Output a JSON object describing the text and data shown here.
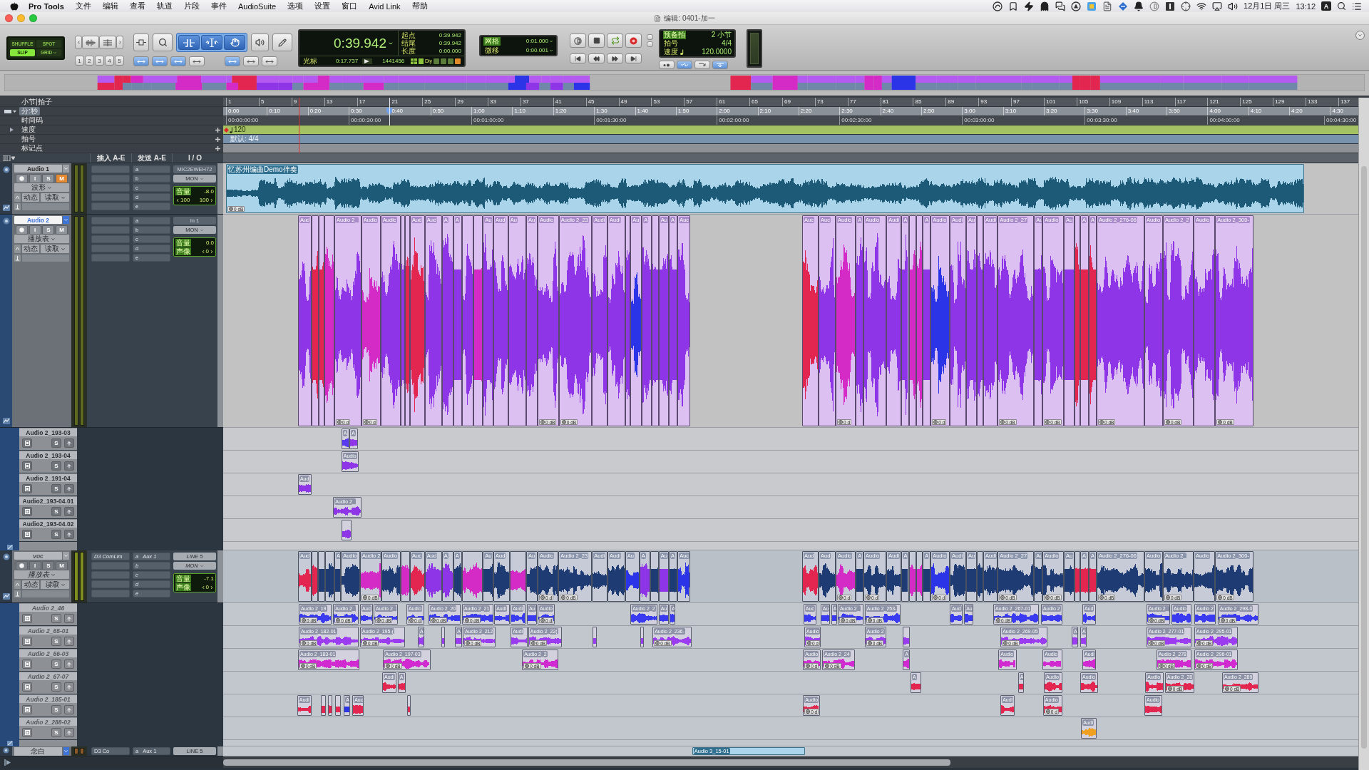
{
  "menu_bar": {
    "app": "Pro Tools",
    "items": [
      "文件",
      "编辑",
      "查看",
      "轨道",
      "片段",
      "事件",
      "AudioSuite",
      "选项",
      "设置",
      "窗口",
      "Avid Link",
      "帮助"
    ],
    "input_source": "A",
    "date": "12月1日 周三",
    "time": "13:12"
  },
  "window": {
    "title": "编辑: 0401-加一"
  },
  "toolbar": {
    "edit_modes": [
      {
        "label": "SHUFFLE",
        "selected": false
      },
      {
        "label": "SPOT",
        "selected": false
      },
      {
        "label": "SLIP",
        "selected": true
      },
      {
        "label": "GRID",
        "selected": false
      }
    ],
    "zoom_presets": [
      "1",
      "2",
      "3",
      "4",
      "5"
    ],
    "tools": [
      {
        "kind": "zoom",
        "selected": false
      },
      {
        "kind": "trim",
        "selected": true
      },
      {
        "kind": "select",
        "selected": true
      },
      {
        "kind": "grab",
        "selected": true
      },
      {
        "kind": "scrub",
        "selected": false
      },
      {
        "kind": "pencil",
        "selected": false
      }
    ],
    "toggles": [
      {
        "on": true
      },
      {
        "on": true
      },
      {
        "on": true
      },
      {
        "on": false
      },
      {
        "on": true
      },
      {
        "on": false
      },
      {
        "on": false
      }
    ],
    "counter": {
      "main": "0:39.942",
      "rows": [
        {
          "label": "起点",
          "value": "0:39.942"
        },
        {
          "label": "结尾",
          "value": "0:39.942"
        },
        {
          "label": "长度",
          "value": "0:00.000"
        }
      ],
      "cursor_label": "光标",
      "cursor": "0:17.737",
      "samples": "1441456",
      "delay": "Dly"
    },
    "grid": {
      "label": "网格",
      "value": "0:01.000"
    },
    "nudge": {
      "label": "微移",
      "value": "0:00.001"
    },
    "tempo": {
      "countoff_label": "预备拍",
      "countoff": "2 小节",
      "meter_label": "拍号",
      "meter": "4/4",
      "tempo_label": "速度",
      "tempo": "120.0000"
    }
  },
  "rulers": [
    {
      "kind": "bars",
      "label": "小节|拍子",
      "selected": false,
      "ticks": [
        "1",
        "5",
        "9",
        "13",
        "17",
        "21",
        "25",
        "29",
        "33",
        "37",
        "41",
        "45",
        "49",
        "53",
        "57",
        "61",
        "65",
        "69",
        "73",
        "77",
        "81",
        "85",
        "89",
        "93",
        "97",
        "101",
        "105",
        "109",
        "113",
        "117",
        "121",
        "125",
        "129",
        "133",
        "137"
      ]
    },
    {
      "kind": "minsec",
      "label": "分:秒",
      "selected": true,
      "ticks": [
        "0:00",
        "0:10",
        "0:20",
        "0:30",
        "0:40",
        "0:50",
        "1:00",
        "1:10",
        "1:20",
        "1:30",
        "1:40",
        "1:50",
        "2:00",
        "2:10",
        "2:20",
        "2:30",
        "2:40",
        "2:50",
        "3:00",
        "3:10",
        "3:20",
        "3:30",
        "3:40",
        "3:50",
        "4:00",
        "4:10",
        "4:20",
        "4:30"
      ]
    },
    {
      "kind": "timecode",
      "label": "时间码",
      "selected": false,
      "ticks": [
        "00:00:00:00",
        "00:00:30:00",
        "00:01:00:00",
        "00:01:30:00",
        "00:02:00:00",
        "00:02:30:00",
        "00:03:00:00",
        "00:03:30:00",
        "00:04:00:00",
        "00:04:30:00"
      ]
    },
    {
      "kind": "tempo",
      "label": "速度",
      "selected": false,
      "value": "120"
    },
    {
      "kind": "meter",
      "label": "拍号",
      "selected": false,
      "value": "默认: 4/4"
    },
    {
      "kind": "markers",
      "label": "标记点",
      "selected": false
    }
  ],
  "columns": [
    "插入 A-E",
    "发送 A-E",
    "I / O"
  ],
  "tracks": [
    {
      "kind": "audio",
      "name": "Audio 1",
      "selected": false,
      "inactive": false,
      "controls": [
        {
          "kind": "record",
          "on": false
        },
        {
          "kind": "input",
          "label": "I",
          "on": false
        },
        {
          "kind": "solo",
          "label": "S",
          "on": false
        },
        {
          "kind": "mute",
          "label": "M",
          "on": true
        }
      ],
      "view": "波形",
      "automation": "动态",
      "mode": "读取",
      "sends": [
        {
          "slot": "a"
        },
        {
          "slot": "b"
        },
        {
          "slot": "c"
        },
        {
          "slot": "d"
        },
        {
          "slot": "e"
        }
      ],
      "io": {
        "input": "MIC2EWEH72",
        "output": "MON",
        "volume_label": "音量",
        "volume": "-8.0",
        "pan": [
          {
            "value": "100"
          },
          {
            "value": "100"
          }
        ]
      },
      "clips": [
        {
          "label": "忆苏州编曲Demo伴奏",
          "gain": "0 dB"
        }
      ]
    },
    {
      "kind": "audio",
      "name": "Audio 2",
      "selected": true,
      "inactive": false,
      "controls": [
        {
          "kind": "record",
          "on": false
        },
        {
          "kind": "input",
          "label": "I",
          "on": false
        },
        {
          "kind": "solo",
          "label": "S",
          "on": false
        },
        {
          "kind": "mute",
          "label": "M",
          "on": false
        }
      ],
      "view": "播放表",
      "automation": "动态",
      "mode": "读取",
      "sends": [
        {
          "slot": "a"
        },
        {
          "slot": "b"
        },
        {
          "slot": "c"
        },
        {
          "slot": "d"
        },
        {
          "slot": "e"
        }
      ],
      "io": {
        "input": "In 1",
        "output": "MON",
        "volume_label": "音量",
        "volume": "0.0",
        "pan_label": "声像",
        "pan": [
          {
            "value": "0"
          }
        ]
      },
      "clips": [
        {
          "label": "Aud",
          "color": "#8f35e8"
        },
        {
          "color": "#e2264f"
        },
        {
          "color": "#e2264f"
        },
        {
          "color": "#d42ac6"
        },
        {
          "label": "Audio 2_",
          "color": "#8f35e8",
          "gain": "0 d"
        },
        {
          "label": "Audio",
          "color": "#d42ac6",
          "gain": "0 d"
        },
        {
          "label": "Audic",
          "color": "#8f35e8"
        },
        {
          "color": "#8f35e8"
        },
        {
          "color": "#e2264f"
        },
        {
          "label": "Aud",
          "color": "#e2264f"
        },
        {
          "label": "Aud",
          "color": "#8f35e8"
        },
        {
          "label": "A",
          "color": "#8f35e8"
        },
        {
          "label": "A",
          "color": "#8f35e8"
        },
        {
          "color": "#8f35e8"
        },
        {
          "color": "#d42ac6"
        },
        {
          "label": "Au",
          "color": "#8f35e8"
        },
        {
          "label": "Aud",
          "color": "#8f35e8"
        },
        {
          "label": "Au",
          "color": "#8f35e8"
        },
        {
          "label": "Au",
          "color": "#8f35e8"
        },
        {
          "label": "Audio",
          "color": "#8f35e8",
          "gain": "0 dB"
        },
        {
          "label": "Audio 2_23",
          "color": "#8f35e8",
          "gain": "0 dB"
        },
        {
          "label": "Audi",
          "color": "#8f35e8"
        },
        {
          "label": "Audi",
          "color": "#8f35e8"
        },
        {
          "color": "#8f35e8"
        },
        {
          "label": "Au",
          "color": "#2b34e6"
        },
        {
          "label": "A",
          "color": "#8f35e8"
        },
        {
          "color": "#8f35e8"
        },
        {
          "label": "Au",
          "color": "#8f35e8"
        },
        {
          "label": "A",
          "color": "#8f35e8"
        },
        {
          "label": "Auc",
          "color": "#8f35e8"
        },
        {
          "label": "Auc",
          "color": "#e2264f"
        },
        {
          "label": "Auc",
          "color": "#8f35e8"
        },
        {
          "label": "Audio",
          "color": "#d42ac6",
          "gain": "0 d"
        },
        {
          "label": "A",
          "color": "#8f35e8"
        },
        {
          "label": "Audio",
          "color": "#8f35e8"
        },
        {
          "label": "Audi",
          "color": "#8f35e8"
        },
        {
          "label": "A",
          "color": "#8f35e8"
        },
        {
          "color": "#d42ac6"
        },
        {
          "color": "#d42ac6"
        },
        {
          "label": "A",
          "color": "#8f35e8"
        },
        {
          "label": "Audio",
          "color": "#2b34e6",
          "gain": "0 d"
        },
        {
          "label": "Audi",
          "color": "#8f35e8"
        },
        {
          "label": "Au",
          "color": "#8f35e8"
        },
        {
          "color": "#8f35e8"
        },
        {
          "label": "Audi",
          "color": "#8f35e8"
        },
        {
          "label": "Audio 2_27",
          "color": "#8f35e8",
          "gain": "0 dB"
        },
        {
          "label": "Au",
          "color": "#8f35e8"
        },
        {
          "label": "Audio",
          "color": "#8f35e8",
          "gain": "0 dB"
        },
        {
          "label": "Au",
          "color": "#8f35e8"
        },
        {
          "color": "#e2264f"
        },
        {
          "label": "A",
          "color": "#e2264f"
        },
        {
          "label": "A",
          "color": "#e2264f"
        },
        {
          "label": "Audio 2_276-06",
          "color": "#8f35e8",
          "gain": "0 dB"
        },
        {
          "label": "Audio",
          "color": "#8f35e8"
        },
        {
          "label": "Audio 2_2",
          "color": "#8f35e8",
          "gain": "0 dB"
        },
        {
          "label": "Audio",
          "color": "#8f35e8"
        },
        {
          "label": "Audio 2_300-",
          "color": "#8f35e8",
          "gain": "0 dB"
        }
      ],
      "lanes": [
        {
          "name": "Audio 2_193-03",
          "solo": {
            "label": "S",
            "on": false
          },
          "clips": [
            {
              "label": "A",
              "color": "#5a3cf0"
            },
            {
              "label": "A",
              "color": "#8f35e8"
            }
          ]
        },
        {
          "name": "Audio 2_193-04",
          "solo": {
            "label": "S",
            "on": false
          },
          "clips": [
            {
              "label": "Audio",
              "color": "#8f35e8"
            }
          ]
        },
        {
          "name": "Audio 2_191-04",
          "solo": {
            "label": "S",
            "on": false
          },
          "clips": [
            {
              "label": "Aud",
              "color": "#8f35e8"
            }
          ]
        },
        {
          "name": "Audio2_193-04.01",
          "solo": {
            "label": "S",
            "on": false
          },
          "clips": [
            {
              "label": "Audio 2_",
              "color": "#8f35e8"
            }
          ]
        },
        {
          "name": "Audio2_193-04.02",
          "solo": {
            "label": "S",
            "on": false
          },
          "clips": [
            {
              "color": "#8f35e8"
            }
          ]
        }
      ]
    },
    {
      "kind": "audio",
      "name": "voc",
      "selected": false,
      "inactive": true,
      "controls": [
        {
          "kind": "record",
          "on": false
        },
        {
          "kind": "input",
          "label": "I",
          "on": false
        },
        {
          "kind": "solo",
          "label": "S",
          "on": false
        },
        {
          "kind": "mute",
          "label": "M",
          "on": false
        }
      ],
      "view": "播放表",
      "automation": "动态",
      "mode": "读取",
      "inserts": [
        "D3 ComLim"
      ],
      "sends": [
        {
          "slot": "a",
          "name": "Aux 1"
        },
        {
          "slot": "b"
        },
        {
          "slot": "c"
        },
        {
          "slot": "d"
        },
        {
          "slot": "e"
        }
      ],
      "io": {
        "input": "LINE 5",
        "output": "MON",
        "volume_label": "音量",
        "volume": "-7.1",
        "pan_label": "声像",
        "pan": [
          {
            "value": "0"
          }
        ]
      },
      "clips": [
        {
          "label": "Aud",
          "color": "#e2264f"
        },
        {
          "color": "#e2264f"
        },
        {
          "color": "#1f3b73"
        },
        {
          "color": "#1f3b73"
        },
        {
          "label": "A",
          "color": "#1f3b73"
        },
        {
          "label": "Audio",
          "color": "#1f3b73"
        },
        {
          "label": "Audio 2",
          "color": "#d42ac6",
          "gain": "0 dB"
        },
        {
          "label": "Audio",
          "color": "#1f3b73"
        },
        {
          "color": "#d42ac6"
        },
        {
          "label": "Auc",
          "color": "#e2264f"
        },
        {
          "label": "Aud",
          "color": "#8f35e8"
        },
        {
          "label": "A",
          "color": "#8f35e8"
        },
        {
          "label": "A",
          "color": "#1f3b73"
        },
        {
          "color": "#d42ac6"
        },
        {
          "label": "Au",
          "color": "#1f3b73"
        },
        {
          "label": "Aud",
          "color": "#1f3b73"
        },
        {
          "color": "#d42ac6"
        },
        {
          "label": "Au",
          "color": "#1f3b73"
        },
        {
          "label": "Audio",
          "color": "#1f3b73",
          "gain": "0 d"
        },
        {
          "label": "Audio 2_23",
          "color": "#1f3b73",
          "gain": "0 dB"
        },
        {
          "label": "Audi",
          "color": "#1f3b73"
        },
        {
          "label": "Audi",
          "color": "#1f3b73"
        },
        {
          "label": "Au",
          "color": "#2b34e6"
        },
        {
          "label": "A",
          "color": "#8f35e8"
        },
        {
          "color": "#1f3b73"
        },
        {
          "label": "Au",
          "color": "#8f35e8"
        },
        {
          "label": "A",
          "color": "#1f3b73"
        },
        {
          "label": "Auc",
          "color": "#2b34e6"
        },
        {
          "label": "Aud",
          "color": "#e2264f"
        },
        {
          "label": "Aud",
          "color": "#1f3b73"
        },
        {
          "label": "Audio",
          "color": "#d42ac6",
          "gain": "0 d"
        },
        {
          "label": "A",
          "color": "#1f3b73"
        },
        {
          "label": "Audio",
          "color": "#1f3b73",
          "gain": "0 d"
        },
        {
          "label": "Audi",
          "color": "#1f3b73"
        },
        {
          "label": "A",
          "color": "#1f3b73"
        },
        {
          "color": "#d42ac6"
        },
        {
          "color": "#d42ac6"
        },
        {
          "label": "A",
          "color": "#1f3b73"
        },
        {
          "label": "Audio",
          "color": "#2b34e6",
          "gain": "0 d"
        },
        {
          "label": "Audi",
          "color": "#1f3b73"
        },
        {
          "label": "Au",
          "color": "#1f3b73"
        },
        {
          "color": "#1f3b73"
        },
        {
          "label": "Audi",
          "color": "#1f3b73"
        },
        {
          "label": "Audio 2_27",
          "color": "#1f3b73",
          "gain": "0 dB"
        },
        {
          "label": "Au",
          "color": "#1f3b73"
        },
        {
          "label": "Audio",
          "color": "#1f3b73",
          "gain": "0 dB"
        },
        {
          "label": "Au",
          "color": "#1f3b73"
        },
        {
          "color": "#e2264f"
        },
        {
          "label": "A",
          "color": "#e2264f"
        },
        {
          "label": "A",
          "color": "#e2264f"
        },
        {
          "label": "Audio 2_276-06",
          "color": "#1f3b73",
          "gain": "0 dB"
        },
        {
          "label": "Audio",
          "color": "#1f3b73"
        },
        {
          "label": "Audio 2_",
          "color": "#1f3b73",
          "gain": "0 dB"
        },
        {
          "label": "Audio",
          "color": "#1f3b73"
        },
        {
          "label": "Audio 2_300-",
          "color": "#1f3b73",
          "gain": "0 dB"
        }
      ],
      "lanes": [
        {
          "name": "Audio 2_46",
          "solo": {
            "label": "S",
            "on": false
          },
          "clips": [
            {
              "label": "Audio 2_19",
              "color": "#3a3af0",
              "gain": "0 dB"
            },
            {
              "label": "Audio 2_",
              "color": "#3a3af0",
              "gain": "0 dB"
            },
            {
              "label": "Auc",
              "color": "#3a3af0"
            },
            {
              "label": "Audio 2_",
              "color": "#3a3af0",
              "gain": "0 dB"
            },
            {
              "label": "Audio",
              "color": "#3a3af0",
              "gain": "0 d"
            },
            {
              "label": "Audio 2_20",
              "color": "#3a3af0",
              "gain": "0 dB"
            },
            {
              "label": "Audio 2_21",
              "color": "#3a3af0",
              "gain": "0 dB"
            },
            {
              "label": "Audi",
              "color": "#3a3af0"
            },
            {
              "label": "Audi",
              "color": "#3a3af0"
            },
            {
              "label": "Au",
              "color": "#3a3af0"
            },
            {
              "label": "Audio",
              "color": "#3a3af0",
              "gain": "0 d"
            },
            {
              "label": "Audio 2_2",
              "color": "#3a3af0"
            },
            {
              "label": "Au",
              "color": "#3a3af0"
            },
            {
              "label": "A",
              "color": "#3a3af0"
            },
            {
              "label": "Auc",
              "color": "#3a3af0"
            },
            {
              "label": "Au",
              "color": "#3a3af0"
            },
            {
              "label": "A",
              "color": "#3a3af0"
            },
            {
              "label": "Audio 2_",
              "color": "#3a3af0",
              "gain": "0 dB"
            },
            {
              "label": "Audio 2_253-",
              "color": "#3a3af0",
              "gain": "0 dB"
            },
            {
              "label": "Aud",
              "color": "#3a3af0"
            },
            {
              "label": "Au",
              "color": "#3a3af0"
            },
            {
              "label": "Audio 2_267-01",
              "color": "#3a3af0",
              "gain": "0 dB"
            },
            {
              "label": "Audio 2",
              "color": "#3a3af0"
            },
            {
              "label": "Aud",
              "color": "#3a3af0"
            },
            {
              "label": "Audio 2_",
              "color": "#3a3af0",
              "gain": "0 dB"
            },
            {
              "label": "Audio",
              "color": "#3a3af0"
            },
            {
              "label": "Audio 2",
              "color": "#3a3af0"
            },
            {
              "label": "Audio 2_298-0",
              "color": "#3a3af0",
              "gain": "0 dB"
            }
          ]
        },
        {
          "name": "Audio 2_65-01",
          "solo": {
            "label": "S",
            "on": false
          },
          "clips": [
            {
              "label": "Audio 2_182-01",
              "color": "#9b3cf0",
              "gain": "0 dB"
            },
            {
              "label": "Audio 2_195-(",
              "color": "#9b3cf0",
              "gain": "0 dB"
            },
            {
              "label": "A",
              "color": "#9b3cf0"
            },
            {
              "color": "#9b3cf0"
            },
            {
              "label": "A",
              "color": "#9b3cf0"
            },
            {
              "label": "Audio 2_212",
              "color": "#9b3cf0",
              "gain": "0 dB"
            },
            {
              "label": "Audi",
              "color": "#9b3cf0"
            },
            {
              "label": "Audio 2_22(",
              "color": "#9b3cf0",
              "gain": "0 dB"
            },
            {
              "color": "#9b3cf0"
            },
            {
              "color": "#9b3cf0"
            },
            {
              "label": "Audio 2_236-",
              "color": "#9b3cf0",
              "gain": "0 dB"
            },
            {
              "label": "Audio",
              "color": "#9b3cf0",
              "gain": "0 d"
            },
            {
              "label": "Audio 2",
              "color": "#9b3cf0",
              "gain": "0 dB"
            },
            {
              "color": "#9b3cf0"
            },
            {
              "label": "Audio 2_269-05",
              "color": "#9b3cf0",
              "gain": "0 dB"
            },
            {
              "label": "A",
              "color": "#9b3cf0"
            },
            {
              "label": "A",
              "color": "#9b3cf0"
            },
            {
              "label": "Audio 2_277-01",
              "color": "#9b3cf0",
              "gain": "0 dB"
            },
            {
              "label": "Audio 2_295-01",
              "color": "#9b3cf0",
              "gain": "0 dB"
            }
          ]
        },
        {
          "name": "Audio 2_66-03",
          "solo": {
            "label": "S",
            "on": false
          },
          "clips": [
            {
              "label": "Audio 2_183-01",
              "color": "#d02ad0",
              "gain": "0 dB"
            },
            {
              "label": "Audio 2_197-03",
              "color": "#d02ad0",
              "gain": "0 dB"
            },
            {
              "label": "Audio 2_2",
              "color": "#d02ad0",
              "gain": "0 dB"
            },
            {
              "label": "Audio",
              "color": "#d02ad0",
              "gain": "0 d"
            },
            {
              "label": "Audio 2_24",
              "color": "#d02ad0",
              "gain": "0 dB"
            },
            {
              "label": "A",
              "color": "#d02ad0"
            },
            {
              "label": "Audio",
              "color": "#d02ad0"
            },
            {
              "label": "Audio",
              "color": "#d02ad0"
            },
            {
              "label": "Audi",
              "color": "#d02ad0"
            },
            {
              "label": "Audio 2_278",
              "color": "#d02ad0",
              "gain": "0 dB"
            },
            {
              "label": "Audio 2_296-01",
              "color": "#d02ad0",
              "gain": "0 dB"
            }
          ]
        },
        {
          "name": "Audio 2_67-07",
          "solo": {
            "label": "S",
            "on": false
          },
          "clips": [
            {
              "label": "Audi",
              "color": "#e2264f"
            },
            {
              "label": "A",
              "color": "#e2264f"
            },
            {
              "label": "A",
              "color": "#e2264f"
            },
            {
              "label": "A",
              "color": "#e2264f"
            },
            {
              "label": "Audio",
              "color": "#e2264f"
            },
            {
              "label": "Audio",
              "color": "#e2264f"
            },
            {
              "label": "Audio",
              "color": "#e2264f"
            },
            {
              "label": "Audio 2_28",
              "color": "#e2264f",
              "gain": "0 dB"
            },
            {
              "label": "Audio 2_289",
              "color": "#e2264f",
              "gain": "0 dB"
            }
          ]
        },
        {
          "name": "Audio 2_185-01",
          "solo": {
            "label": "S",
            "on": false
          },
          "clips": [
            {
              "label": "Audi",
              "color": "#e2264f"
            },
            {
              "color": "#e2264f"
            },
            {
              "color": "#e2264f"
            },
            {
              "color": "#e2264f"
            },
            {
              "label": "A",
              "color": "#2b34e6"
            },
            {
              "label": "Auc",
              "color": "#e2264f"
            },
            {
              "color": "#e2264f"
            },
            {
              "label": "Audio",
              "color": "#e2264f",
              "gain": "0 d"
            },
            {
              "label": "Audi",
              "color": "#e2264f"
            },
            {
              "label": "Audio",
              "color": "#e2264f",
              "gain": "0 d"
            },
            {
              "label": "Audio",
              "color": "#e2264f"
            }
          ]
        },
        {
          "name": "Audio 2_288-02",
          "solo": {
            "label": "S",
            "on": false
          },
          "clips": [
            {
              "label": "Audi",
              "color": "#f0a020"
            }
          ]
        }
      ]
    },
    {
      "kind": "partial",
      "name": "念白",
      "inserts": [
        "D3 Co"
      ],
      "sends": [
        {
          "slot": "a",
          "name": "Aux 1"
        }
      ],
      "io": {
        "input": "LINE 5"
      },
      "clips": [
        {
          "label": "Audio 3_15-01"
        }
      ]
    }
  ]
}
